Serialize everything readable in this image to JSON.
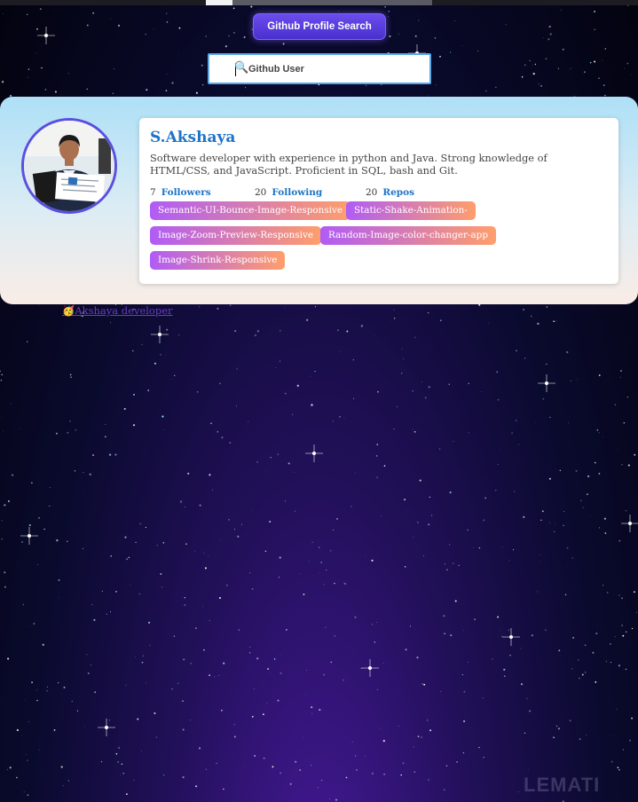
{
  "header": {
    "title_button": "Github Profile Search"
  },
  "search": {
    "icon": "magnifier-icon",
    "placeholder": "Github User",
    "value": ""
  },
  "profile": {
    "name": "S.Akshaya",
    "bio": "Software developer with experience in python and Java. Strong knowledge of HTML/CSS, and JavaScript. Proficient in SQL, bash and Git.",
    "followers_count": "7",
    "followers_label": "Followers",
    "following_count": "20",
    "following_label": "Following",
    "repos_count": "20",
    "repos_label": "Repos",
    "repos": [
      "Semantic-UI-Bounce-Image-Responsive",
      "Static-Shake-Animation-",
      "Image-Zoom-Preview-Responsive",
      "Random-Image-color-changer-app",
      "Image-Shrink-Responsive"
    ]
  },
  "footer": {
    "emoji": "🥳",
    "link_text": "Akshaya developer"
  },
  "watermark": "LEMATI",
  "colors": {
    "accent": "#5a4fe0",
    "name_blue": "#1e74c6",
    "tag_start": "#b05cf5",
    "tag_end": "#ff9e6b"
  }
}
